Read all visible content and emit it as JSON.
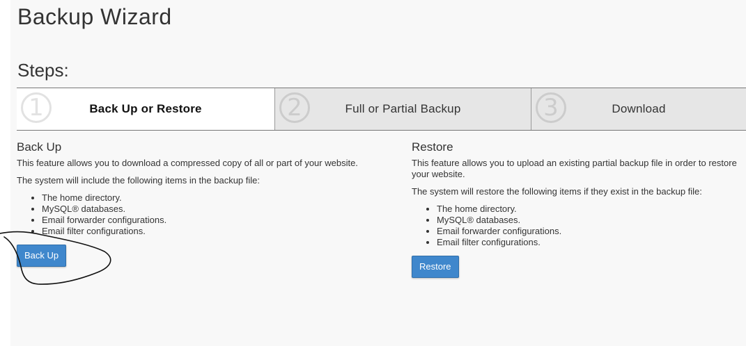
{
  "page": {
    "title": "Backup Wizard"
  },
  "steps": {
    "heading": "Steps:",
    "items": [
      {
        "number": "1",
        "label": "Back Up or Restore",
        "active": true
      },
      {
        "number": "2",
        "label": "Full or Partial Backup",
        "active": false
      },
      {
        "number": "3",
        "label": "Download",
        "active": false
      }
    ]
  },
  "backup": {
    "heading": "Back Up",
    "description": "This feature allows you to download a compressed copy of all or part of your website.",
    "intro": "The system will include the following items in the backup file:",
    "items": [
      "The home directory.",
      "MySQL® databases.",
      "Email forwarder configurations.",
      "Email filter configurations."
    ],
    "button_label": "Back Up"
  },
  "restore": {
    "heading": "Restore",
    "description": "This feature allows you to upload an existing partial backup file in order to restore your website.",
    "intro": "The system will restore the following items if they exist in the backup file:",
    "items": [
      "The home directory.",
      "MySQL® databases.",
      "Email forwarder configurations.",
      "Email filter configurations."
    ],
    "button_label": "Restore"
  },
  "colors": {
    "button_primary": "#3f87cc",
    "active_step_bg": "#ffffff",
    "inactive_step_bg": "#e6e6e6",
    "annotation_ink": "#111111"
  }
}
